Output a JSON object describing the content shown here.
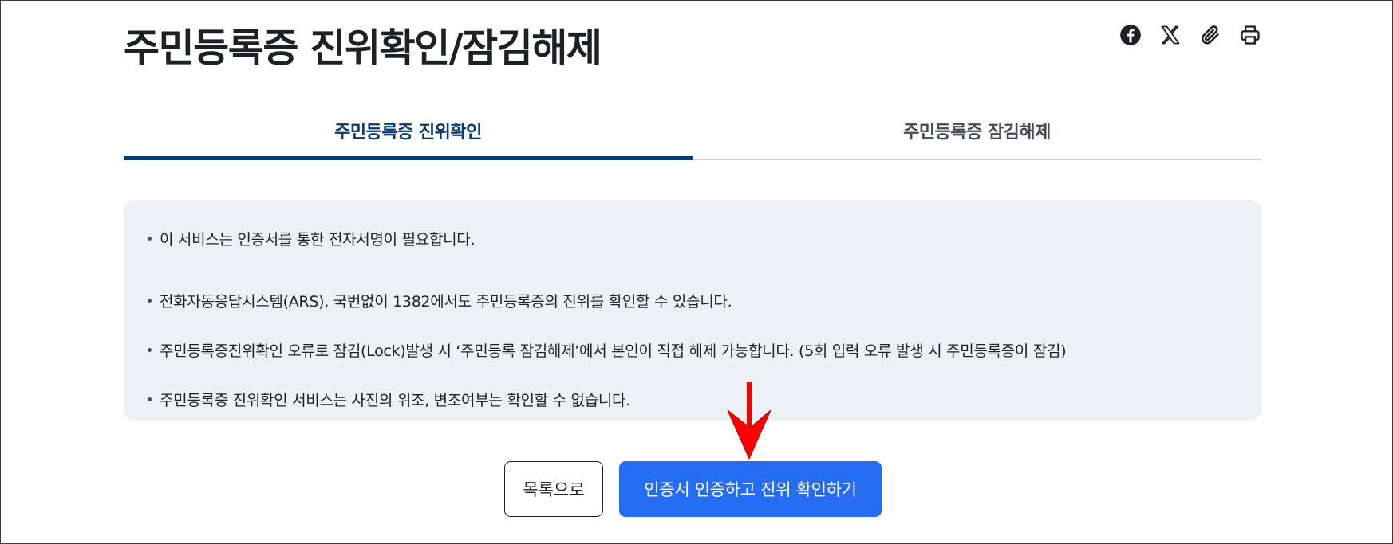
{
  "page": {
    "title": "주민등록증 진위확인/잠김해제"
  },
  "share": {
    "icons": [
      "facebook-icon",
      "x-icon",
      "paperclip-icon",
      "print-icon"
    ]
  },
  "tabs": [
    {
      "label": "주민등록증 진위확인",
      "active": true
    },
    {
      "label": "주민등록증 잠김해제",
      "active": false
    }
  ],
  "notices": [
    "이 서비스는 인증서를 통한 전자서명이 필요합니다.",
    "전화자동응답시스템(ARS), 국번없이 1382에서도 주민등록증의 진위를 확인할 수 있습니다.",
    "주민등록증진위확인 오류로 잠김(Lock)발생 시 ‘주민등록 잠김해제’에서 본인이 직접 해제 가능합니다. (5회 입력 오류 발생 시 주민등록증이 잠김)",
    "주민등록증 진위확인 서비스는 사진의 위조, 변조여부는 확인할 수 없습니다."
  ],
  "buttons": {
    "list_label": "목록으로",
    "confirm_label": "인증서 인증하고 진위 확인하기"
  },
  "colors": {
    "accent": "#256ef4",
    "tab_active": "#0b3a6e",
    "notice_bg": "#edf0f4",
    "annotation_arrow": "#ff0000"
  }
}
